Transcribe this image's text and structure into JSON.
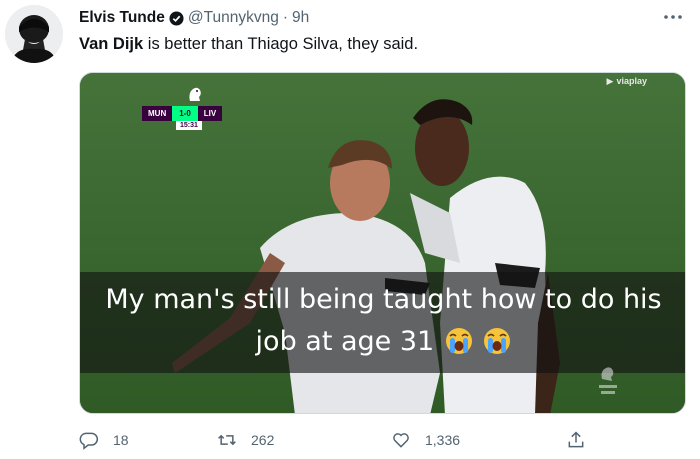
{
  "author": {
    "display_name": "Elvis Tunde",
    "handle": "@Tunnykvng",
    "separator": "·",
    "time": "9h"
  },
  "tweet": {
    "text_bold": "Van Dijk",
    "text_rest": " is better than Thiago Silva, they said."
  },
  "media": {
    "scorebug": {
      "home": "MUN",
      "score": "1-0",
      "away": "LIV",
      "clock": "15:31"
    },
    "broadcaster": "viaplay",
    "caption_line1": "My man's still being taught how to do his",
    "caption_line2": "job at age 31",
    "caption_emoji": "loudly-crying-face"
  },
  "actions": {
    "replies": "18",
    "retweets": "262",
    "likes": "1,336"
  },
  "icons": [
    "verified-icon",
    "more-icon",
    "reply-icon",
    "retweet-icon",
    "like-icon",
    "share-icon"
  ],
  "colors": {
    "text_primary": "#0f1419",
    "text_secondary": "#536471",
    "pl_purple": "#38003c",
    "pl_green": "#00ff85"
  }
}
